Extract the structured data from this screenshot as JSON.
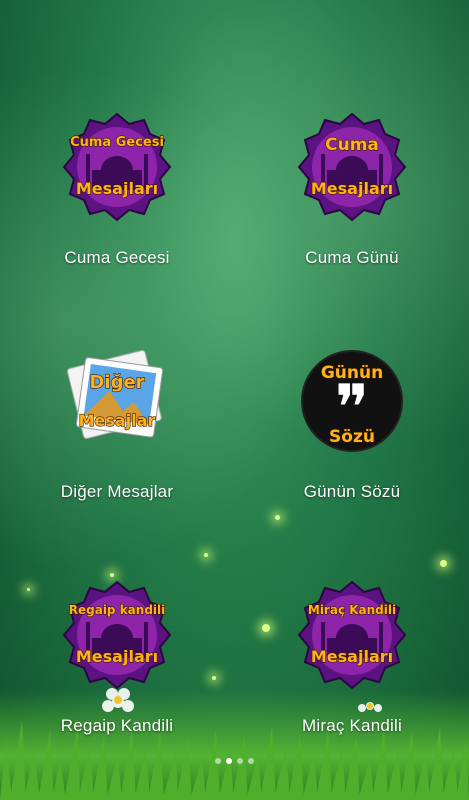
{
  "apps": [
    {
      "label": "Cuma Gecesi",
      "icon": "mosque-badge-icon",
      "badge_line1": "Cuma Gecesi",
      "badge_line2": "Mesajları"
    },
    {
      "label": "Cuma Günü",
      "icon": "mosque-badge-icon",
      "badge_line1": "Cuma",
      "badge_line2": "Mesajları"
    },
    {
      "label": "Diğer Mesajlar",
      "icon": "photos-icon",
      "badge_line1": "Diğer",
      "badge_line2": "Mesajlar"
    },
    {
      "label": "Günün Sözü",
      "icon": "quote-icon",
      "badge_line1": "Günün",
      "badge_line2": "Sözü",
      "glyph": "❞"
    },
    {
      "label": "Regaip Kandili",
      "icon": "mosque-badge-icon",
      "badge_line1": "Regaip kandili",
      "badge_line2": "Mesajları"
    },
    {
      "label": "Miraç Kandili",
      "icon": "mosque-badge-icon",
      "badge_line1": "Miraç Kandili",
      "badge_line2": "Mesajları"
    }
  ],
  "pager": {
    "count": 4,
    "active_index": 1
  },
  "colors": {
    "badge_purple": "#7b1fa2",
    "badge_text": "#ffb21a",
    "label": "#ffffff"
  }
}
